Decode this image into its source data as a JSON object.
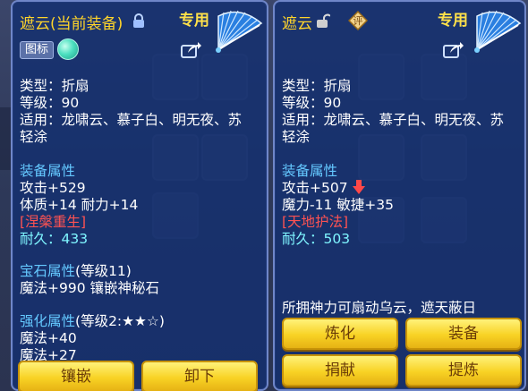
{
  "colors": {
    "panel_bg": "#143070",
    "gold_text": "#ffd42a",
    "attr_blue": "#64c8ff",
    "special_red": "#ff5252",
    "durability_cyan": "#7ff5ff",
    "button_yellow": "#f8d224"
  },
  "left": {
    "title": "遮云",
    "title_status": "(当前装备)",
    "lock_icon": "lock-icon",
    "badge": "专用",
    "icon_tag": "图标",
    "type": "类型：折扇",
    "level": "等级：90",
    "suitable_line1": "适用：龙啸云、慕子白、明无夜、苏",
    "suitable_line2": "轻涂",
    "equip_attr_heading": "装备属性",
    "attack": "攻击+529",
    "stats": "体质+14  耐力+14",
    "special": "[涅槃重生]",
    "durability_label": "耐久：",
    "durability_value": "433",
    "gem_heading": "宝石属性",
    "gem_level": "(等级11)",
    "gem_effect": "魔法+990  镶嵌神秘石",
    "enhance_heading": "强化属性",
    "enhance_level": "(等级2:★★☆)",
    "enhance_1": "魔法+40",
    "enhance_2": "魔法+27",
    "buttons": [
      "镶嵌",
      "卸下"
    ]
  },
  "right": {
    "title": "遮云",
    "unlock_icon": "unlock-icon",
    "rating_badge": "评",
    "badge": "专用",
    "type": "类型：折扇",
    "level": "等级：90",
    "suitable_line1": "适用：龙啸云、慕子白、明无夜、苏",
    "suitable_line2": "轻涂",
    "equip_attr_heading": "装备属性",
    "attack": "攻击+507",
    "stats": "魔力-11  敏捷+35",
    "special": "[天地护法]",
    "durability_label": "耐久：",
    "durability_value": "503",
    "description": "所拥神力可扇动乌云，遮天蔽日",
    "buttons": [
      "炼化",
      "装备",
      "捐献",
      "提炼"
    ]
  }
}
